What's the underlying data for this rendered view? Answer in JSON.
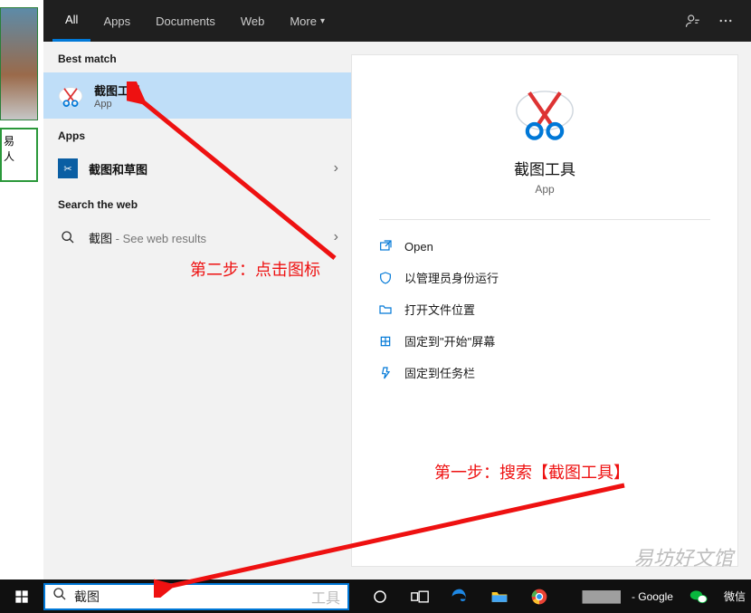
{
  "tabs": {
    "all": "All",
    "apps": "Apps",
    "documents": "Documents",
    "web": "Web",
    "more": "More"
  },
  "section": {
    "best_match": "Best match",
    "apps": "Apps",
    "search_web": "Search the web"
  },
  "best": {
    "title": "截图工具",
    "subtitle": "App"
  },
  "app_result": {
    "title": "截图和草图"
  },
  "web_result": {
    "prefix": "截图",
    "suffix": " - See web results"
  },
  "preview": {
    "title": "截图工具",
    "subtitle": "App"
  },
  "actions": {
    "open": "Open",
    "run_admin": "以管理员身份运行",
    "open_location": "打开文件位置",
    "pin_start": "固定到\"开始\"屏幕",
    "pin_taskbar": "固定到任务栏"
  },
  "search": {
    "value": "截图",
    "placeholder": "工具"
  },
  "taskbar": {
    "google_suffix": " - Google",
    "wechat": "微信"
  },
  "annotations": {
    "step1": "第一步：搜索【截图工具】",
    "step2": "第二步：点击图标"
  },
  "watermark": "易坊好文馆"
}
